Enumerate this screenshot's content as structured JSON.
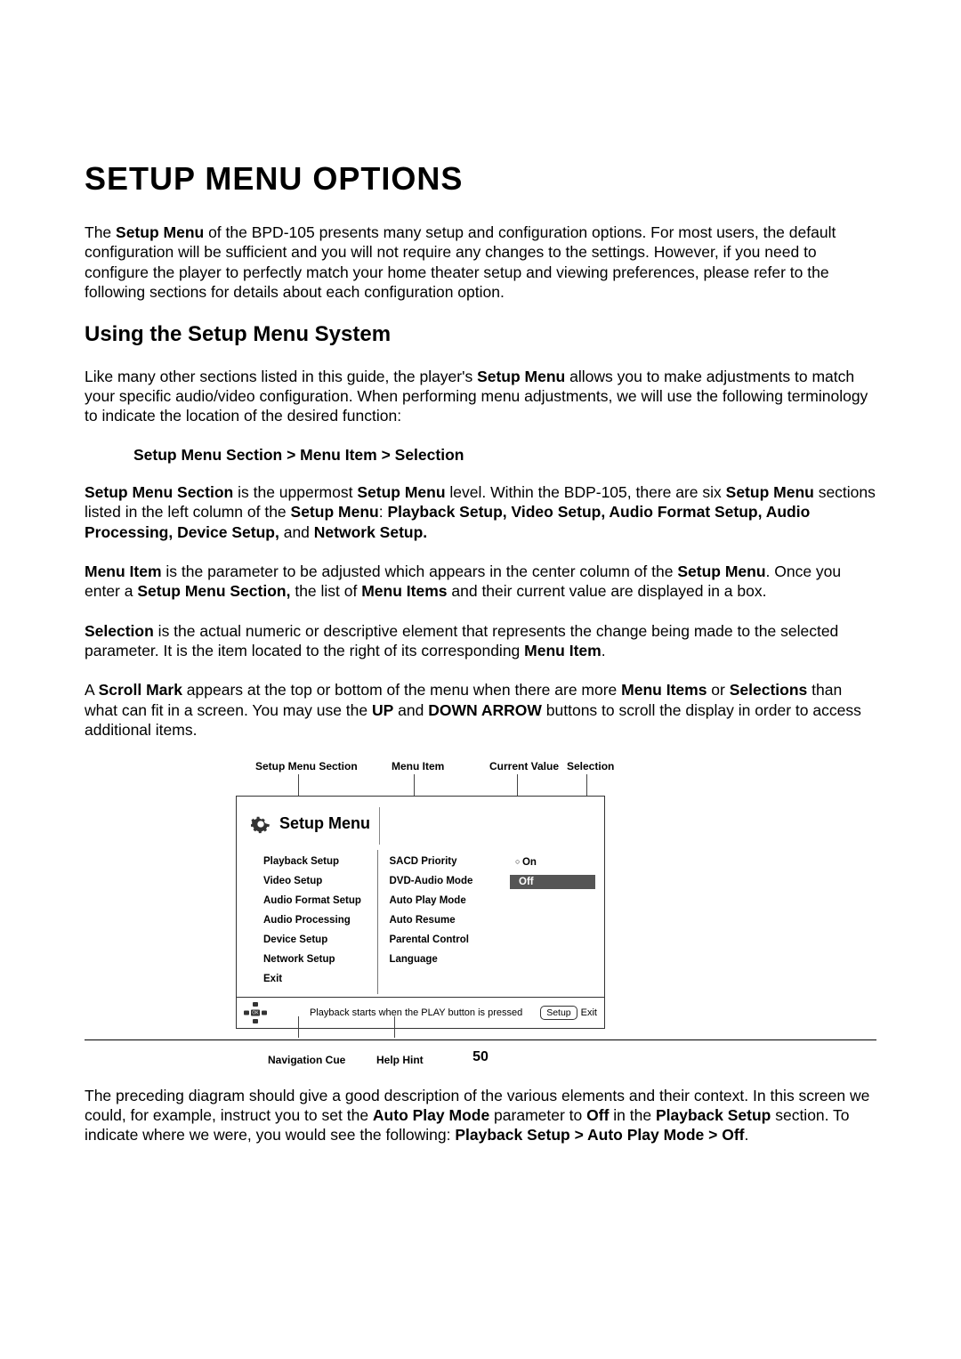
{
  "page": {
    "title": "SETUP MENU OPTIONS",
    "intro_parts": {
      "p1a": "The ",
      "p1b": "Setup Menu",
      "p1c": " of the BPD-105 presents many setup and configuration options. For most users, the default configuration will be sufficient and you will not require any changes to the settings. However, if you need to configure the player to perfectly match your home theater setup and viewing preferences, please refer to the following sections for details about each configuration option."
    },
    "h2": "Using the Setup Menu System",
    "para2": {
      "a": "Like many other sections listed in this guide, the player's ",
      "b": "Setup Menu",
      "c": " allows you to make adjustments to match your specific audio/video configuration. When performing menu adjustments, we will use the following terminology to indicate the location of the desired function:"
    },
    "breadcrumb_example": "Setup Menu Section > Menu Item > Selection",
    "para3": {
      "a": "Setup Menu Section",
      "b": " is the uppermost ",
      "c": "Setup Menu",
      "d": " level. Within the BDP-105, there are six ",
      "e": "Setup Menu",
      "f": " sections listed in the left column of the ",
      "g": "Setup Menu",
      "h": ": ",
      "i": "Playback Setup, Video Setup, Audio Format Setup, Audio Processing, Device Setup,",
      "j": " and ",
      "k": "Network Setup."
    },
    "para4": {
      "a": "Menu Item",
      "b": " is the parameter to be adjusted which appears in the center column of the ",
      "c": "Setup Menu",
      "d": ". Once you enter a ",
      "e": "Setup Menu Section,",
      "f": " the list of ",
      "g": "Menu Items",
      "h": " and their current value are displayed in a box."
    },
    "para5": {
      "a": "Selection",
      "b": " is the actual numeric or descriptive element that represents the change being made to the selected parameter. It is the item located to the right of its corresponding ",
      "c": "Menu Item",
      "d": "."
    },
    "para6": {
      "a": "A ",
      "b": "Scroll Mark",
      "c": " appears at the top or bottom of the menu when there are more ",
      "d": "Menu Items",
      "e": " or ",
      "f": "Selections",
      "g": " than what can fit in a screen. You may use the ",
      "h": "UP",
      "i": " and ",
      "j": "DOWN ARROW",
      "k": " buttons to scroll the display in order to access additional items."
    },
    "diagram": {
      "top_labels": {
        "section": "Setup Menu Section",
        "item": "Menu Item",
        "value": "Current Value",
        "selection": "Selection"
      },
      "panel_title": "Setup Menu",
      "sections": [
        "Playback Setup",
        "Video Setup",
        "Audio Format Setup",
        "Audio Processing",
        "Device Setup",
        "Network Setup",
        "Exit"
      ],
      "items": [
        "SACD Priority",
        "DVD-Audio Mode",
        "Auto Play Mode",
        "Auto Resume",
        "Parental Control",
        "Language"
      ],
      "values": {
        "on": "On",
        "off": "Off"
      },
      "help_hint": "Playback starts when the PLAY button is pressed",
      "setup_btn": "Setup",
      "exit_btn": "Exit",
      "bottom_labels": {
        "nav": "Navigation Cue",
        "help": "Help Hint"
      }
    },
    "para7": {
      "a": "The preceding diagram should give a good description of the various elements and their context. In this screen we could, for example, instruct you to set the ",
      "b": "Auto Play Mode",
      "c": " parameter to ",
      "d": "Off",
      "e": " in the ",
      "f": "Playback Setup",
      "g": " section. To indicate where we were, you would see the following: ",
      "h": "Playback Setup > Auto Play Mode > Off",
      "i": "."
    },
    "page_number": "50"
  }
}
